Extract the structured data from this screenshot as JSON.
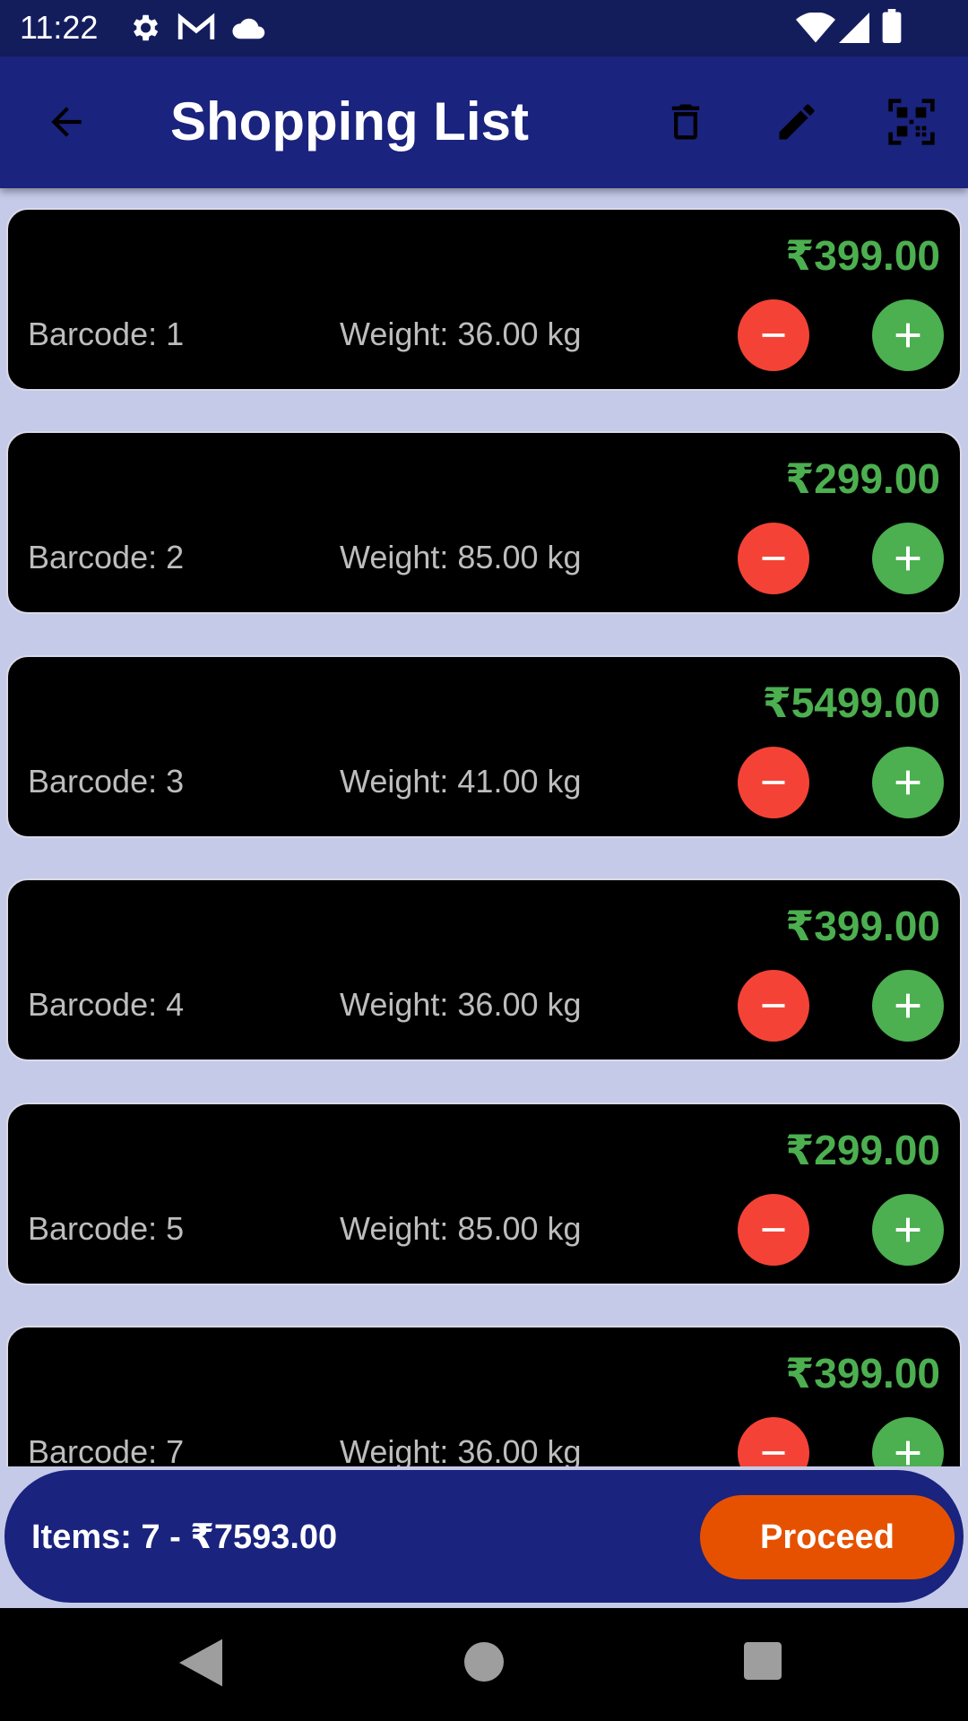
{
  "status_bar": {
    "time": "11:22",
    "left_icons": [
      "settings-icon",
      "gmail-icon",
      "cloud-icon"
    ],
    "right_icons": [
      "wifi-icon",
      "signal-icon",
      "battery-icon"
    ]
  },
  "app_bar": {
    "title": "Shopping List",
    "icons": [
      "back-arrow-icon",
      "delete-icon",
      "edit-icon",
      "qr-scan-icon"
    ]
  },
  "items": [
    {
      "price": "₹399.00",
      "barcode": "Barcode: 1",
      "weight": "Weight: 36.00 kg"
    },
    {
      "price": "₹299.00",
      "barcode": "Barcode: 2",
      "weight": "Weight: 85.00 kg"
    },
    {
      "price": "₹5499.00",
      "barcode": "Barcode: 3",
      "weight": "Weight: 41.00 kg"
    },
    {
      "price": "₹399.00",
      "barcode": "Barcode: 4",
      "weight": "Weight: 36.00 kg"
    },
    {
      "price": "₹299.00",
      "barcode": "Barcode: 5",
      "weight": "Weight: 85.00 kg"
    },
    {
      "price": "₹399.00",
      "barcode": "Barcode: 7",
      "weight": "Weight: 36.00 kg"
    }
  ],
  "summary": {
    "text": "Items: 7 - ₹7593.00",
    "proceed_label": "Proceed"
  },
  "nav_bar": {
    "icons": [
      "back-triangle-icon",
      "home-circle-icon",
      "recents-square-icon"
    ]
  },
  "colors": {
    "primary": "#1a237e",
    "status_bar": "#141d5c",
    "background": "#c5cae9",
    "card": "#000000",
    "price": "#4caf50",
    "minus": "#f44336",
    "plus": "#4caf50",
    "proceed": "#e65100"
  }
}
